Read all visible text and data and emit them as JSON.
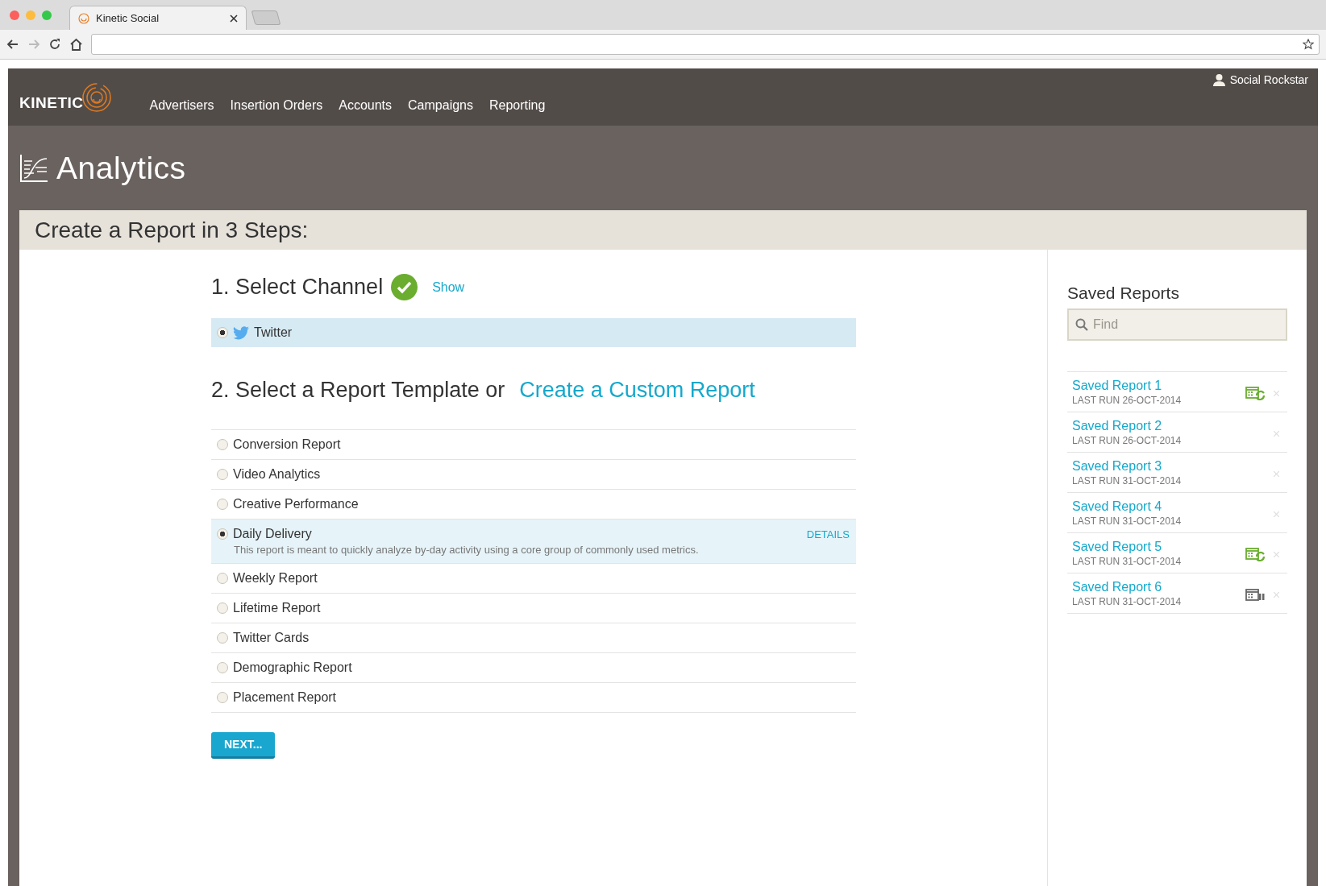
{
  "browser": {
    "tab_title": "Kinetic Social"
  },
  "header": {
    "logo": "KINETIC",
    "nav": [
      "Advertisers",
      "Insertion Orders",
      "Accounts",
      "Campaigns",
      "Reporting"
    ],
    "user": "Social Rockstar"
  },
  "page_title": "Analytics",
  "card_title": "Create a Report in 3 Steps:",
  "step1": {
    "title": "1. Select Channel",
    "done": true,
    "show_link": "Show",
    "channels": [
      {
        "label": "Twitter",
        "selected": true
      }
    ]
  },
  "step2": {
    "title": "2. Select a Report Template or",
    "custom_link": "Create a Custom Report",
    "templates": [
      {
        "label": "Conversion Report",
        "selected": false
      },
      {
        "label": "Video Analytics",
        "selected": false
      },
      {
        "label": "Creative Performance",
        "selected": false
      },
      {
        "label": "Daily Delivery",
        "selected": true,
        "description": "This report is meant to quickly analyze by-day activity using a core group of commonly used metrics.",
        "details_link": "DETAILS"
      },
      {
        "label": "Weekly Report",
        "selected": false
      },
      {
        "label": "Lifetime Report",
        "selected": false
      },
      {
        "label": "Twitter Cards",
        "selected": false
      },
      {
        "label": "Demographic Report",
        "selected": false
      },
      {
        "label": "Placement Report",
        "selected": false
      }
    ]
  },
  "next_button": "NEXT...",
  "saved_reports": {
    "title": "Saved Reports",
    "search": {
      "placeholder": "Find"
    },
    "items": [
      {
        "name": "Saved Report 1",
        "last_run": "LAST RUN 26-OCT-2014",
        "kind": "recurring"
      },
      {
        "name": "Saved Report 2",
        "last_run": "LAST RUN 26-OCT-2014",
        "kind": "plain"
      },
      {
        "name": "Saved Report 3",
        "last_run": "LAST RUN 31-OCT-2014",
        "kind": "plain"
      },
      {
        "name": "Saved Report 4",
        "last_run": "LAST RUN 31-OCT-2014",
        "kind": "plain"
      },
      {
        "name": "Saved Report 5",
        "last_run": "LAST RUN 31-OCT-2014",
        "kind": "recurring"
      },
      {
        "name": "Saved Report 6",
        "last_run": "LAST RUN 31-OCT-2014",
        "kind": "paused"
      }
    ]
  }
}
